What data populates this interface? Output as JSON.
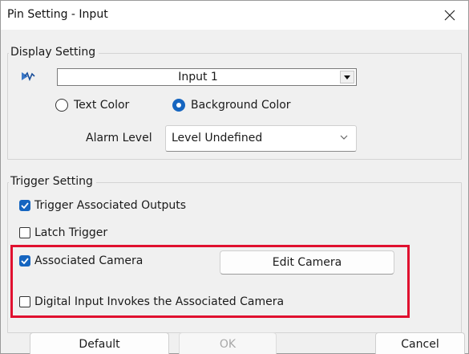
{
  "window": {
    "title": "Pin Setting - Input"
  },
  "display_setting": {
    "legend": "Display Setting",
    "input_select": {
      "value": "Input 1"
    },
    "color_mode": {
      "options": [
        "Text Color",
        "Background Color"
      ],
      "selected": "Background Color"
    },
    "alarm_level": {
      "label": "Alarm Level",
      "value": "Level Undefined"
    }
  },
  "trigger_setting": {
    "legend": "Trigger Setting",
    "checkboxes": [
      {
        "label": "Trigger Associated Outputs",
        "checked": true
      },
      {
        "label": "Latch Trigger",
        "checked": false
      },
      {
        "label": "Associated Camera",
        "checked": true
      },
      {
        "label": "Digital Input Invokes the Associated Camera",
        "checked": false
      }
    ],
    "edit_camera_label": "Edit Camera"
  },
  "footer": {
    "default_label": "Default",
    "ok_label": "OK",
    "cancel_label": "Cancel"
  },
  "colors": {
    "accent": "#1565c0",
    "highlight": "#e0102f",
    "dialog_bg": "#f0f0f0"
  }
}
